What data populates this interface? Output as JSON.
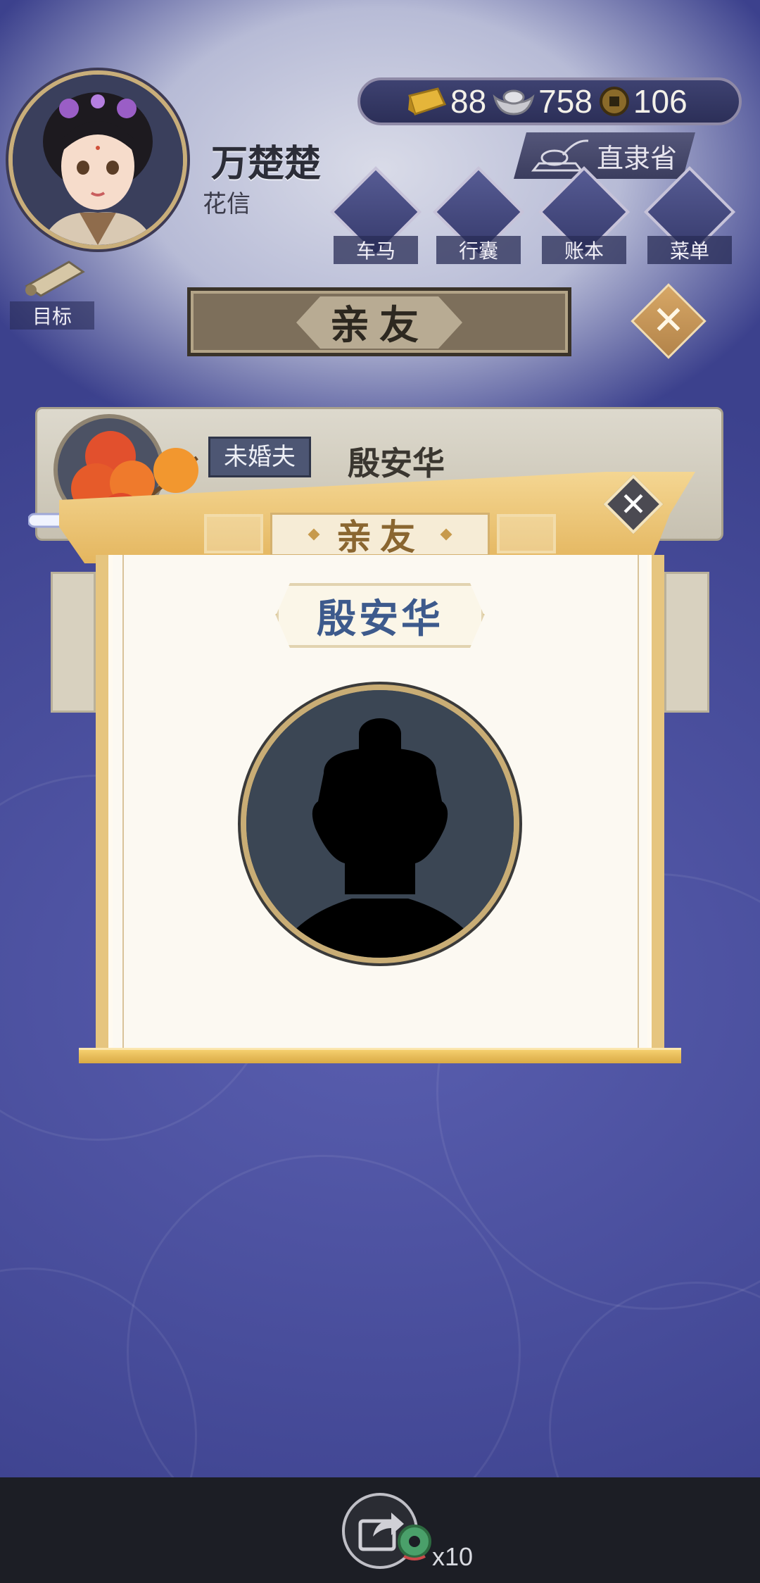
{
  "player": {
    "name": "万楚楚",
    "title": "花信"
  },
  "currency": {
    "gold": "88",
    "silver": "758",
    "coin": "106"
  },
  "region": "直隶省",
  "nav": {
    "carriage": "车马",
    "bag": "行囊",
    "ledger": "账本",
    "menu": "菜单",
    "goal": "目标"
  },
  "page_title": "亲友",
  "relative_card": {
    "relation": "未婚夫",
    "name": "殷安华"
  },
  "dialog": {
    "title": "亲友",
    "name": "殷安华"
  },
  "share": {
    "count": "x10"
  },
  "icons": {
    "gold": "gold-ingot-icon",
    "silver": "silver-ingot-icon",
    "coin": "copper-coin-icon",
    "region": "region-badge-icon",
    "carriage": "carriage-icon",
    "bag": "bag-icon",
    "ledger": "ledger-icon",
    "menu": "more-dots-icon",
    "goal": "scroll-icon",
    "share": "share-icon"
  }
}
